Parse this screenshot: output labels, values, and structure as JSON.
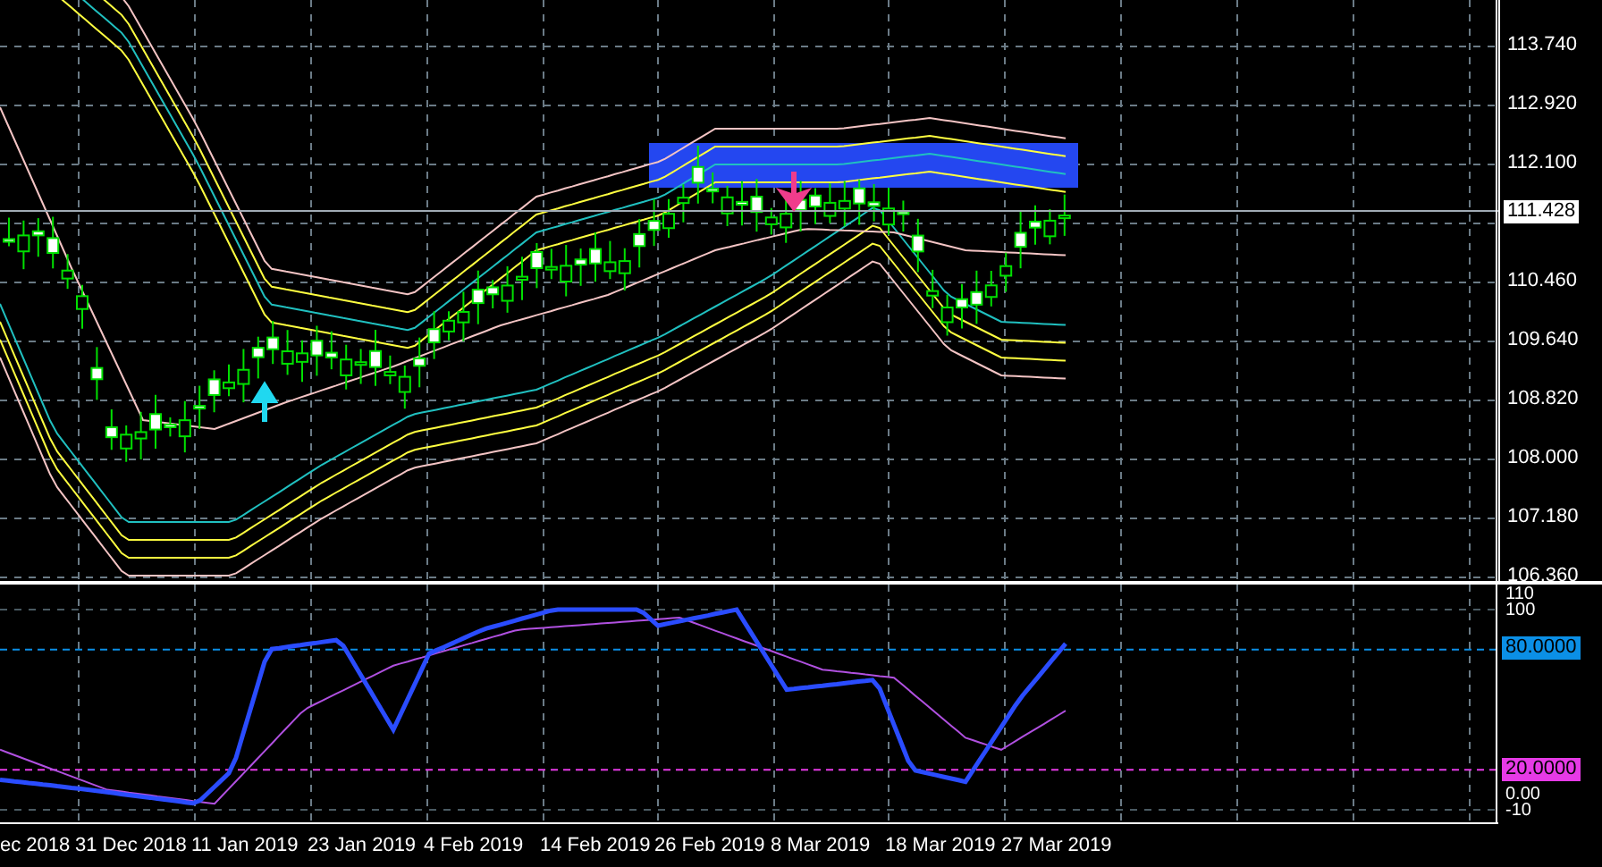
{
  "price_chart": {
    "price_axis": [
      "113.740",
      "112.920",
      "112.100",
      "110.460",
      "109.640",
      "108.820",
      "108.000",
      "107.180",
      "106.360"
    ],
    "current_price": "111.428"
  },
  "oscillator": {
    "axis": [
      "110",
      "100",
      "0.00",
      "-10"
    ],
    "levels": [
      {
        "label": "80.0000",
        "color": "#0b8fe6"
      },
      {
        "label": "20.0000",
        "color": "#e63ae6"
      }
    ]
  },
  "time_axis": [
    "ec 2018",
    "31 Dec 2018",
    "11 Jan 2019",
    "23 Jan 2019",
    "4 Feb 2019",
    "14 Feb 2019",
    "26 Feb 2019",
    "8 Mar 2019",
    "18 Mar 2019",
    "27 Mar 2019"
  ]
}
